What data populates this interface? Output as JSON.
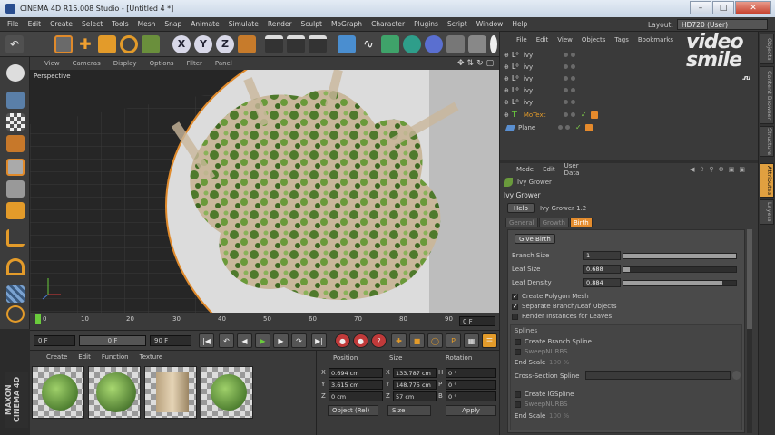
{
  "window": {
    "title": "CINEMA 4D R15.008 Studio - [Untitled 4 *]"
  },
  "menus": [
    "File",
    "Edit",
    "Create",
    "Select",
    "Tools",
    "Mesh",
    "Snap",
    "Animate",
    "Simulate",
    "Render",
    "Sculpt",
    "MoGraph",
    "Character",
    "Plugins",
    "Script",
    "Window",
    "Help"
  ],
  "layout": {
    "label": "Layout:",
    "value": "HD720 (User)"
  },
  "viewport": {
    "menu": [
      "View",
      "Cameras",
      "Display",
      "Options",
      "Filter",
      "Panel"
    ],
    "label": "Perspective"
  },
  "timeline": {
    "ticks": [
      "0",
      "10",
      "20",
      "30",
      "40",
      "50",
      "60",
      "70",
      "80",
      "90"
    ],
    "frame": "0 F"
  },
  "playbar": {
    "start": "0 F",
    "min": "0 F",
    "max": "90 F",
    "end": "90 F"
  },
  "materials": {
    "menu": [
      "Create",
      "Edit",
      "Function",
      "Texture"
    ]
  },
  "branding": {
    "maxon": "MAXON CINEMA 4D",
    "watermark": "video smile",
    "watermark_sub": ".ru"
  },
  "coords": {
    "headers": {
      "position": "Position",
      "size": "Size",
      "rotation": "Rotation"
    },
    "rows": [
      {
        "axis": "X",
        "pos": "0.694 cm",
        "size_axis": "X",
        "size": "133.787 cm",
        "rot_axis": "H",
        "rot": "0 °"
      },
      {
        "axis": "Y",
        "pos": "3.615 cm",
        "size_axis": "Y",
        "size": "148.775 cm",
        "rot_axis": "P",
        "rot": "0 °"
      },
      {
        "axis": "Z",
        "pos": "0 cm",
        "size_axis": "Z",
        "size": "57 cm",
        "rot_axis": "B",
        "rot": "0 °"
      }
    ],
    "mode": "Object (Rel)",
    "size_mode": "Size",
    "apply": "Apply"
  },
  "objects": {
    "menu": [
      "File",
      "Edit",
      "View",
      "Objects",
      "Tags",
      "Bookmarks"
    ],
    "items": [
      {
        "name": "ivy",
        "type": "lo"
      },
      {
        "name": "ivy",
        "type": "lo"
      },
      {
        "name": "ivy",
        "type": "lo"
      },
      {
        "name": "ivy",
        "type": "lo"
      },
      {
        "name": "ivy",
        "type": "lo"
      },
      {
        "name": "MoText",
        "type": "text"
      },
      {
        "name": "Plane",
        "type": "plane"
      }
    ]
  },
  "attributes": {
    "menu": [
      "Mode",
      "Edit",
      "User Data"
    ],
    "object_name": "Ivy Grower",
    "section": "Ivy Grower",
    "help": "Help",
    "version": "Ivy Grower 1.2",
    "tabs": [
      "General",
      "Growth",
      "Birth"
    ],
    "active_tab": "Birth",
    "give_birth": "Give Birth",
    "params": [
      {
        "label": "Branch Size",
        "value": "1",
        "fill": 1.0
      },
      {
        "label": "Leaf Size",
        "value": "0.688",
        "fill": 0.06
      },
      {
        "label": "Leaf Density",
        "value": "0.884",
        "fill": 0.88
      }
    ],
    "checks": [
      {
        "label": "Create Polygon Mesh",
        "checked": true
      },
      {
        "label": "Separate Branch/Leaf Objects",
        "checked": true
      },
      {
        "label": "Render Instances for Leaves",
        "checked": false
      }
    ],
    "splines": {
      "title": "Splines",
      "create_branch": "Create Branch Spline",
      "sweep1": "SweepNURBS",
      "end_scale": "End Scale",
      "end_scale_value": "100 %",
      "cross_section": "Cross-Section Spline",
      "create_ig": "Create IGSpline",
      "sweep2": "SweepNURBS",
      "end_scale2": "End Scale",
      "end_scale2_value": "100 %"
    }
  },
  "side_tabs": [
    "Objects",
    "Content Browser",
    "Structure",
    "Attributes",
    "Layers"
  ]
}
